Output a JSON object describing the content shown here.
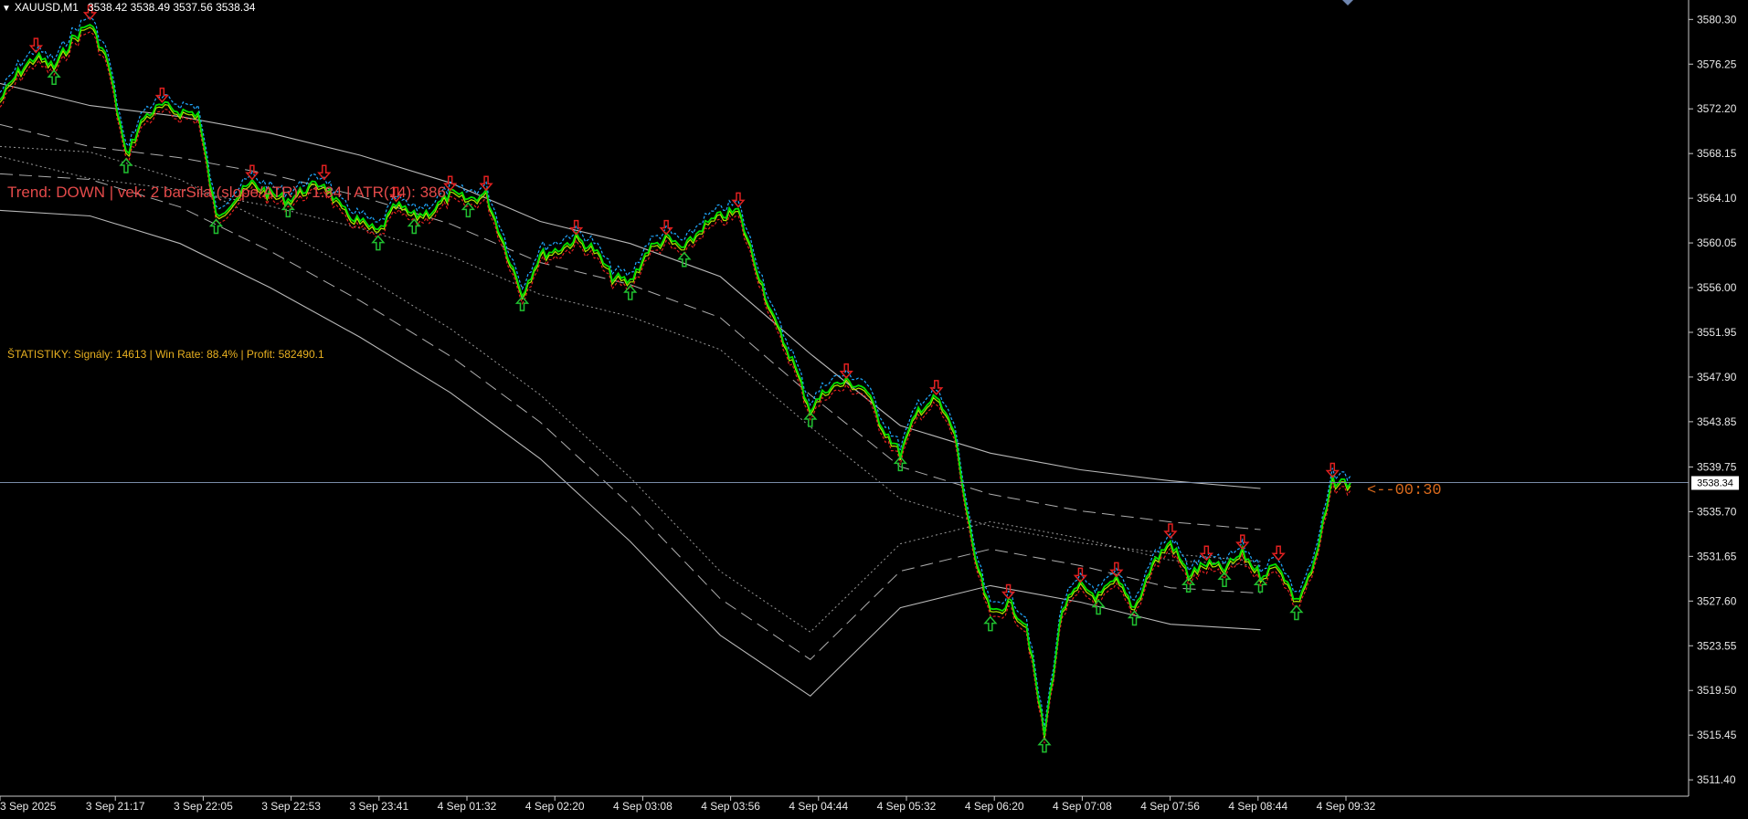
{
  "header": {
    "symbol": "XAUUSD,M1",
    "ohlc": "3538.42 3538.49 3537.56 3538.34"
  },
  "annotations": {
    "trend": "Trend: DOWN | vek: 2 barSila (slope/ATR): -1.84 | ATR(14): 386",
    "stats": "ŠTATISTIKY: Signály: 14613 | Win Rate: 88.4% | Profit: 582490.1",
    "timer": "<--00:30"
  },
  "colors": {
    "background": "#000000",
    "price_up": "#00e000",
    "price_alt": "#b4e600",
    "band_upper": "#20a8ff",
    "band_lower": "#e02020",
    "envelope": "#d8d8d8",
    "arrow_up": "#20c030",
    "arrow_down": "#e02020",
    "current_price_line": "#7a8ca8"
  },
  "chart_data": {
    "type": "line",
    "title": "XAUUSD,M1",
    "x_tick_labels": [
      "3 Sep 2025",
      "3 Sep 21:17",
      "3 Sep 22:05",
      "3 Sep 22:53",
      "3 Sep 23:41",
      "4 Sep 01:32",
      "4 Sep 02:20",
      "4 Sep 03:08",
      "4 Sep 03:56",
      "4 Sep 04:44",
      "4 Sep 05:32",
      "4 Sep 06:20",
      "4 Sep 07:08",
      "4 Sep 07:56",
      "4 Sep 08:44",
      "4 Sep 09:32"
    ],
    "y_tick_labels": [
      "3580.30",
      "3576.25",
      "3572.20",
      "3568.15",
      "3564.10",
      "3560.05",
      "3556.00",
      "3551.95",
      "3547.90",
      "3543.85",
      "3539.75",
      "3535.70",
      "3531.65",
      "3527.60",
      "3523.55",
      "3519.50",
      "3515.45",
      "3511.40"
    ],
    "ylim": [
      3510.5,
      3581.4
    ],
    "current_price": 3538.34,
    "current_price_label": "3538.34",
    "x_index_range": [
      0,
      150
    ],
    "series": [
      {
        "name": "XAUUSD,M1",
        "role": "price",
        "x": [
          0,
          2,
          4,
          6,
          8,
          10,
          12,
          14,
          16,
          18,
          20,
          22,
          24,
          26,
          28,
          30,
          32,
          34,
          36,
          38,
          40,
          42,
          44,
          46,
          48,
          50,
          52,
          54,
          56,
          58,
          60,
          62,
          64,
          66,
          68,
          70,
          72,
          74,
          76,
          78,
          80,
          82,
          84,
          86,
          88,
          90,
          92,
          94,
          96,
          98,
          100,
          102,
          104,
          106,
          108,
          110,
          112,
          114,
          116,
          118,
          120,
          122,
          124,
          126,
          128,
          130,
          132,
          134,
          136,
          138,
          140,
          142,
          144,
          146,
          148,
          150
        ],
        "values": [
          3573.0,
          3575.5,
          3577.0,
          3576.0,
          3578.5,
          3580.0,
          3576.5,
          3568.0,
          3571.5,
          3572.5,
          3572.0,
          3571.8,
          3562.5,
          3564.0,
          3565.5,
          3564.5,
          3564.0,
          3565.0,
          3565.5,
          3563.0,
          3562.0,
          3561.0,
          3563.5,
          3562.5,
          3563.0,
          3564.5,
          3564.0,
          3564.5,
          3560.0,
          3555.5,
          3559.0,
          3559.5,
          3560.5,
          3559.5,
          3557.0,
          3556.5,
          3559.5,
          3560.5,
          3559.5,
          3561.5,
          3562.5,
          3563.0,
          3558.0,
          3553.0,
          3549.5,
          3545.0,
          3547.0,
          3547.5,
          3547.0,
          3543.5,
          3541.0,
          3545.0,
          3546.0,
          3543.0,
          3532.5,
          3526.5,
          3527.5,
          3525.5,
          3515.5,
          3527.0,
          3529.0,
          3528.0,
          3529.5,
          3527.0,
          3531.0,
          3533.0,
          3530.0,
          3531.0,
          3530.5,
          3532.0,
          3530.0,
          3531.0,
          3527.5,
          3531.0,
          3538.5,
          3538.3
        ]
      },
      {
        "name": "upper-envelope",
        "role": "envelope",
        "x": [
          0,
          10,
          20,
          30,
          40,
          50,
          60,
          70,
          80,
          90,
          100,
          110,
          120,
          130,
          140
        ],
        "values": [
          3574.5,
          3572.5,
          3571.5,
          3570.0,
          3568.0,
          3565.5,
          3562.0,
          3560.0,
          3557.0,
          3550.0,
          3543.5,
          3541.0,
          3539.5,
          3538.5,
          3537.8
        ]
      },
      {
        "name": "lower-envelope",
        "role": "envelope",
        "x": [
          0,
          10,
          20,
          30,
          40,
          50,
          60,
          70,
          80,
          90,
          100,
          110,
          120,
          130,
          140
        ],
        "values": [
          3563.0,
          3562.5,
          3560.0,
          3556.0,
          3551.5,
          3546.5,
          3540.5,
          3533.0,
          3524.5,
          3519.0,
          3527.0,
          3529.0,
          3527.5,
          3525.5,
          3525.0
        ]
      }
    ]
  }
}
